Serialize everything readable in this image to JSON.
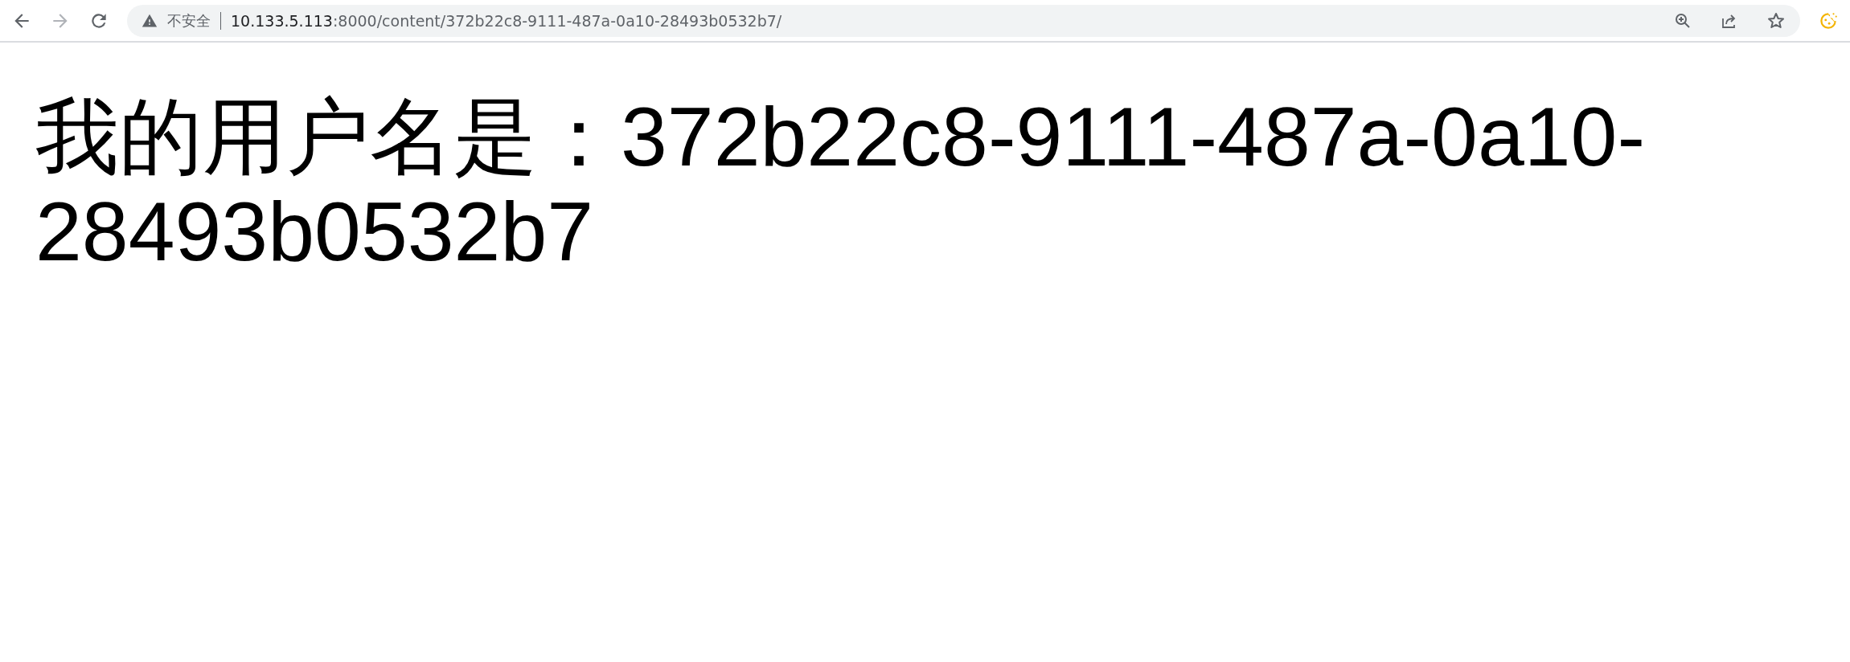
{
  "toolbar": {
    "security_label": "不安全",
    "url_host": "10.133.5.113",
    "url_rest": ":8000/content/372b22c8-9111-487a-0a10-28493b0532b7/",
    "forward_disabled": true
  },
  "page": {
    "heading": "我的用户名是：372b22c8-9111-487a-0a10-28493b0532b7"
  }
}
